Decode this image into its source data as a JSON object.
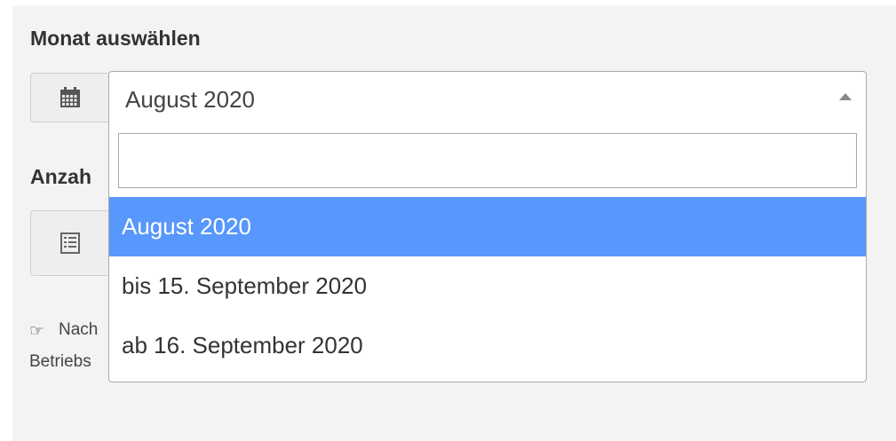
{
  "form": {
    "month_label": "Monat auswählen",
    "count_label": "Anzah",
    "hint_line1": "Nach",
    "hint_line2": "Betriebs"
  },
  "icons": {
    "calendar": "calendar-icon",
    "list": "list-icon",
    "hint": "pointing-hand-icon",
    "dropdown_arrow": "caret-up-icon"
  },
  "month_select": {
    "selected": "August 2020",
    "search_value": "",
    "options": [
      "August 2020",
      "bis 15. September 2020",
      "ab 16. September 2020"
    ],
    "highlighted_index": 0
  },
  "colors": {
    "highlight": "#5897fb",
    "panel_bg": "#f3f3f3"
  }
}
